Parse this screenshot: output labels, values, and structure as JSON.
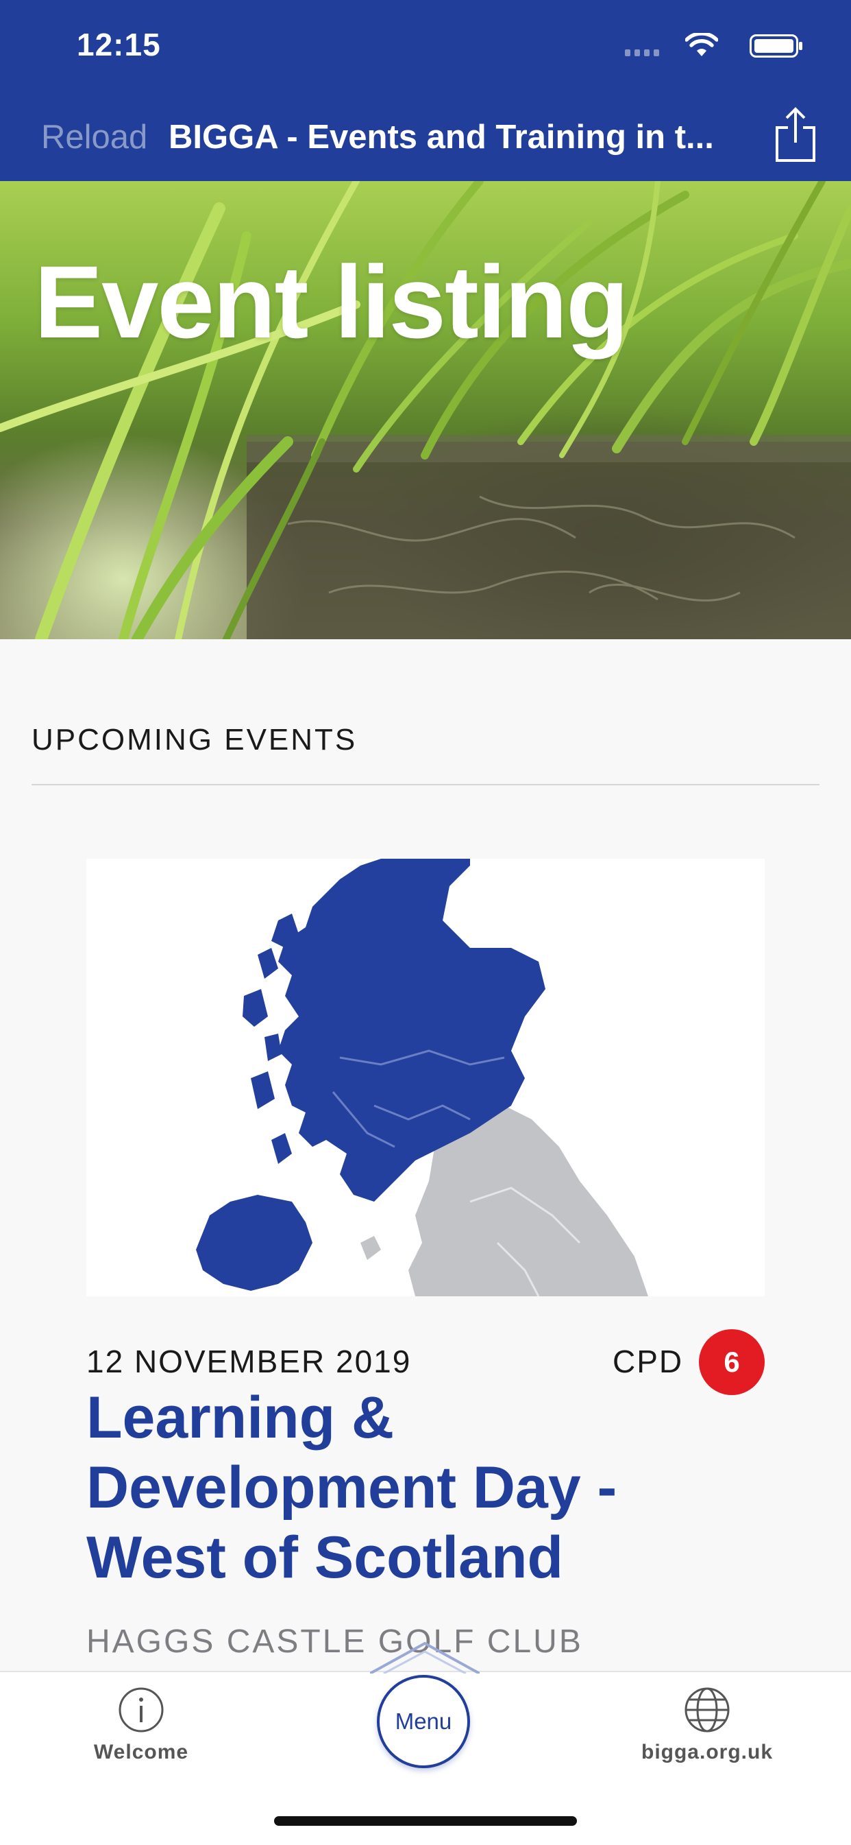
{
  "status_bar": {
    "time": "12:15"
  },
  "nav": {
    "reload_label": "Reload",
    "title": "BIGGA - Events and Training in t..."
  },
  "hero": {
    "title": "Event listing"
  },
  "section": {
    "heading": "UPCOMING EVENTS"
  },
  "event": {
    "date": "12 NOVEMBER 2019",
    "cpd_label": "CPD",
    "cpd_points": "6",
    "title": "Learning & Development Day - West of Scotland",
    "venue": "HAGGS CASTLE GOLF CLUB",
    "map": {
      "highlight_color": "#24409e",
      "other_color": "#c2c3c7"
    }
  },
  "tabbar": {
    "welcome_label": "Welcome",
    "menu_label": "Menu",
    "website_label": "bigga.org.uk"
  },
  "colors": {
    "brand_blue": "#213f9a",
    "badge_red": "#e31b23"
  },
  "icons": {
    "welcome": "info-circle-icon",
    "website": "globe-icon",
    "share": "share-icon"
  }
}
